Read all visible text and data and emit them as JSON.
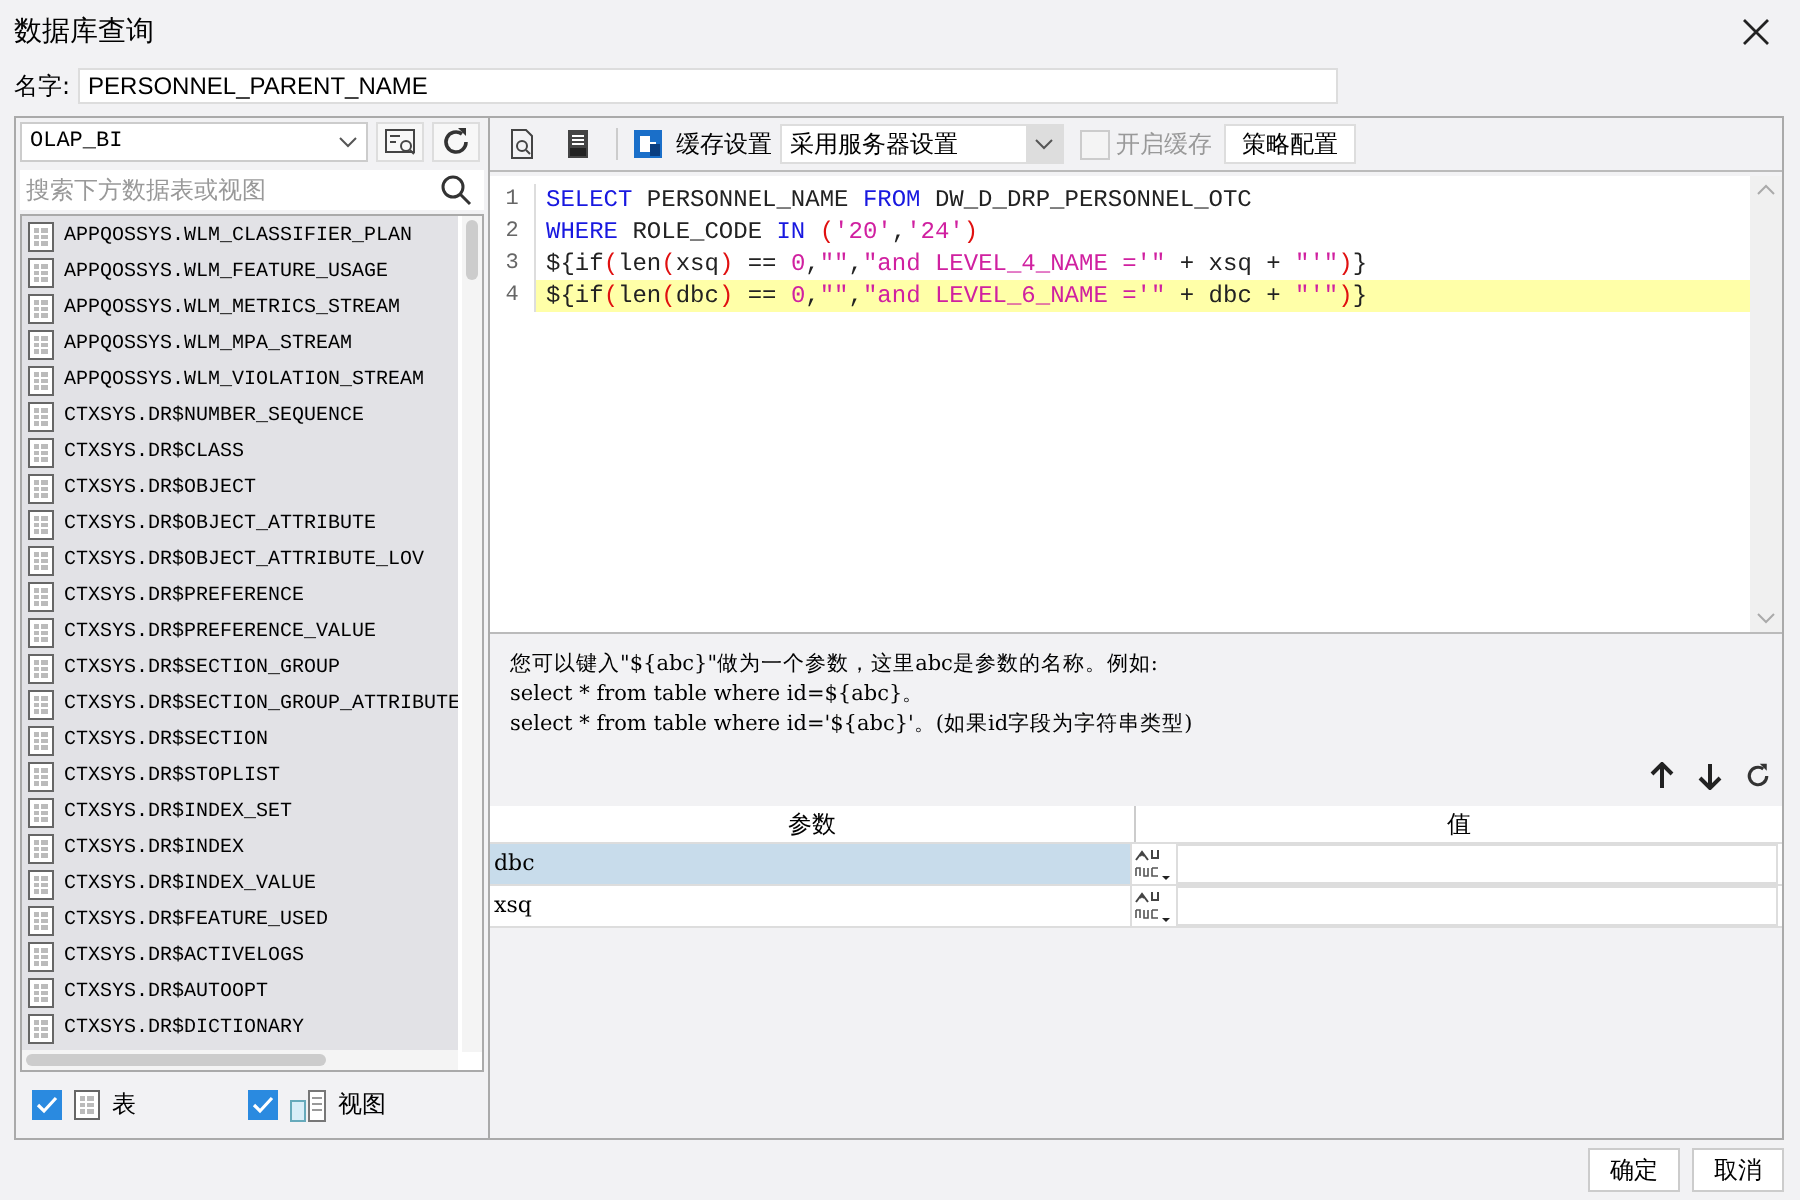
{
  "window": {
    "title": "数据库查询"
  },
  "name_field": {
    "label": "名字:",
    "value": "PERSONNEL_PARENT_NAME"
  },
  "datasource": {
    "value": "OLAP_BI"
  },
  "search": {
    "placeholder": "搜索下方数据表或视图"
  },
  "tables": [
    "APPQOSSYS.WLM_CLASSIFIER_PLAN",
    "APPQOSSYS.WLM_FEATURE_USAGE",
    "APPQOSSYS.WLM_METRICS_STREAM",
    "APPQOSSYS.WLM_MPA_STREAM",
    "APPQOSSYS.WLM_VIOLATION_STREAM",
    "CTXSYS.DR$NUMBER_SEQUENCE",
    "CTXSYS.DR$CLASS",
    "CTXSYS.DR$OBJECT",
    "CTXSYS.DR$OBJECT_ATTRIBUTE",
    "CTXSYS.DR$OBJECT_ATTRIBUTE_LOV",
    "CTXSYS.DR$PREFERENCE",
    "CTXSYS.DR$PREFERENCE_VALUE",
    "CTXSYS.DR$SECTION_GROUP",
    "CTXSYS.DR$SECTION_GROUP_ATTRIBUTE",
    "CTXSYS.DR$SECTION",
    "CTXSYS.DR$STOPLIST",
    "CTXSYS.DR$INDEX_SET",
    "CTXSYS.DR$INDEX",
    "CTXSYS.DR$INDEX_VALUE",
    "CTXSYS.DR$FEATURE_USED",
    "CTXSYS.DR$ACTIVELOGS",
    "CTXSYS.DR$AUTOOPT",
    "CTXSYS.DR$DICTIONARY"
  ],
  "filters": [
    {
      "label": "表",
      "checked": true,
      "kind": "table"
    },
    {
      "label": "视图",
      "checked": true,
      "kind": "view"
    }
  ],
  "toolbar": {
    "cache_label": "缓存设置",
    "cache_mode": "采用服务器设置",
    "enable_cache": {
      "label": "开启缓存",
      "checked": false,
      "disabled": true
    },
    "strategy_button": "策略配置"
  },
  "code_lines": [
    {
      "number": "1",
      "highlighted": false,
      "tokens": [
        {
          "kind": "keyword",
          "text": "SELECT"
        },
        {
          "kind": "plain",
          "text": " PERSONNEL_NAME "
        },
        {
          "kind": "keyword",
          "text": "FROM"
        },
        {
          "kind": "plain",
          "text": " DW_D_DRP_PERSONNEL_OTC"
        }
      ]
    },
    {
      "number": "2",
      "highlighted": false,
      "tokens": [
        {
          "kind": "keyword",
          "text": "WHERE"
        },
        {
          "kind": "plain",
          "text": " ROLE_CODE "
        },
        {
          "kind": "keyword",
          "text": "IN"
        },
        {
          "kind": "paren",
          "text": " ("
        },
        {
          "kind": "string",
          "text": "'20'"
        },
        {
          "kind": "plain",
          "text": ","
        },
        {
          "kind": "string",
          "text": "'24'"
        },
        {
          "kind": "paren",
          "text": ")"
        }
      ]
    },
    {
      "number": "3",
      "highlighted": false,
      "tokens": [
        {
          "kind": "plain",
          "text": "${if"
        },
        {
          "kind": "paren",
          "text": "("
        },
        {
          "kind": "plain",
          "text": "len"
        },
        {
          "kind": "paren",
          "text": "("
        },
        {
          "kind": "plain",
          "text": "xsq"
        },
        {
          "kind": "paren",
          "text": ")"
        },
        {
          "kind": "plain",
          "text": " == "
        },
        {
          "kind": "string",
          "text": "0"
        },
        {
          "kind": "plain",
          "text": ","
        },
        {
          "kind": "string",
          "text": "\"\""
        },
        {
          "kind": "plain",
          "text": ","
        },
        {
          "kind": "string",
          "text": "\"and LEVEL_4_NAME ='\""
        },
        {
          "kind": "plain",
          "text": " + xsq + "
        },
        {
          "kind": "string",
          "text": "\"'\""
        },
        {
          "kind": "paren",
          "text": ")"
        },
        {
          "kind": "plain",
          "text": "}"
        }
      ]
    },
    {
      "number": "4",
      "highlighted": true,
      "tokens": [
        {
          "kind": "plain",
          "text": "${if"
        },
        {
          "kind": "paren",
          "text": "("
        },
        {
          "kind": "plain",
          "text": "len"
        },
        {
          "kind": "paren",
          "text": "("
        },
        {
          "kind": "plain",
          "text": "dbc"
        },
        {
          "kind": "paren",
          "text": ")"
        },
        {
          "kind": "plain",
          "text": " == "
        },
        {
          "kind": "string",
          "text": "0"
        },
        {
          "kind": "plain",
          "text": ","
        },
        {
          "kind": "string",
          "text": "\"\""
        },
        {
          "kind": "plain",
          "text": ","
        },
        {
          "kind": "string",
          "text": "\"and LEVEL_6_NAME ='\""
        },
        {
          "kind": "plain",
          "text": " + dbc + "
        },
        {
          "kind": "string",
          "text": "\"'\""
        },
        {
          "kind": "paren",
          "text": ")"
        },
        {
          "kind": "plain",
          "text": "}"
        }
      ]
    }
  ],
  "hint_lines": [
    "您可以键入\"${abc}\"做为一个参数，这里abc是参数的名称。例如:",
    "select * from table where id=${abc}。",
    "select * from table where id='${abc}'。(如果id字段为字符串类型)"
  ],
  "param_table": {
    "columns": [
      "参数",
      "值"
    ],
    "rows": [
      {
        "name": "dbc",
        "selected": true
      },
      {
        "name": "xsq",
        "selected": false
      }
    ]
  },
  "buttons": [
    "确定",
    "取消"
  ]
}
